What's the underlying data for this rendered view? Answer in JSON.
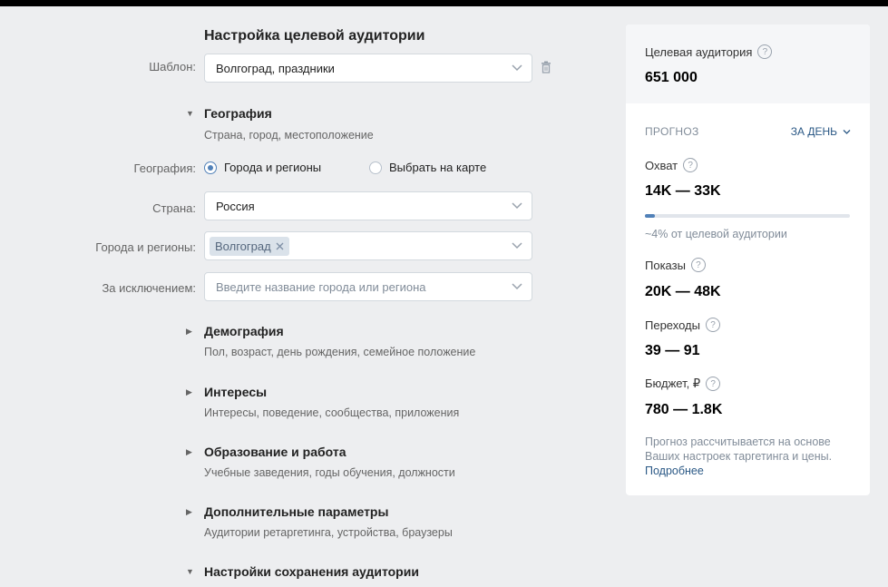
{
  "header": {
    "title": "Настройка целевой аудитории"
  },
  "template": {
    "label": "Шаблон:",
    "value": "Волгоград, праздники"
  },
  "geography": {
    "title": "География",
    "subtitle": "Страна, город, местоположение",
    "mode_label": "География:",
    "option_cities": "Города и регионы",
    "option_map": "Выбрать на карте",
    "country_label": "Страна:",
    "country_value": "Россия",
    "cities_label": "Города и регионы:",
    "city_token": "Волгоград",
    "except_label": "За исключением:",
    "except_placeholder": "Введите название города или региона"
  },
  "sections": [
    {
      "title": "Демография",
      "subtitle": "Пол, возраст, день рождения, семейное положение"
    },
    {
      "title": "Интересы",
      "subtitle": "Интересы, поведение, сообщества, приложения"
    },
    {
      "title": "Образование и работа",
      "subtitle": "Учебные заведения, годы обучения, должности"
    },
    {
      "title": "Дополнительные параметры",
      "subtitle": "Аудитории ретаргетинга, устройства, браузеры"
    },
    {
      "title": "Настройки сохранения аудитории"
    }
  ],
  "panel": {
    "audience_label": "Целевая аудитория",
    "audience_value": "651 000",
    "forecast_label": "ПРОГНОЗ",
    "period": "ЗА ДЕНЬ",
    "reach_label": "Охват",
    "reach_value": "14K — 33K",
    "reach_fraction": 0.04,
    "reach_note": "~4% от целевой аудитории",
    "impressions_label": "Показы",
    "impressions_value": "20K — 48K",
    "clicks_label": "Переходы",
    "clicks_value": "39 — 91",
    "budget_label": "Бюджет, ₽",
    "budget_value": "780 — 1.8K",
    "footnote": "Прогноз рассчитывается на основе Ваших настроек таргетинга и цены.",
    "more_link": "Подробнее"
  },
  "colors": {
    "accent": "#5181b8",
    "link": "#2a5885",
    "background": "#edeef0"
  }
}
